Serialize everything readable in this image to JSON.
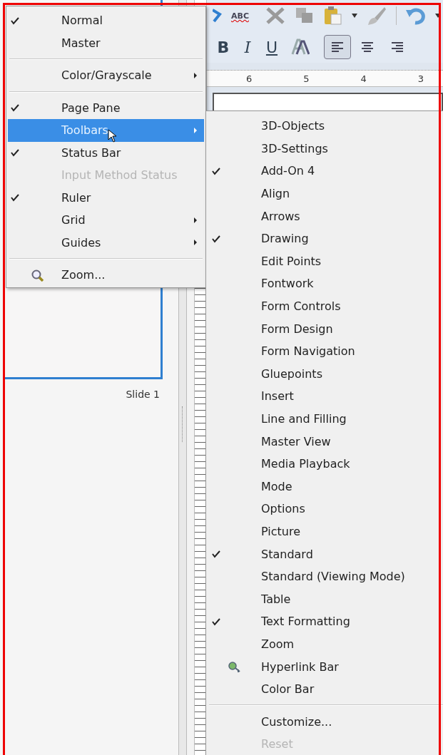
{
  "spelling_icon_text": "ABC",
  "format_buttons": [
    {
      "label": "B",
      "kind": "bold"
    },
    {
      "label": "I",
      "kind": "italic"
    },
    {
      "label": "U",
      "kind": "underline"
    }
  ],
  "align_buttons": [
    {
      "pressed": true
    },
    {
      "pressed": false
    },
    {
      "pressed": false
    }
  ],
  "ruler": {
    "labels": [
      "6",
      "5",
      "4",
      "3"
    ]
  },
  "slide_pane": {
    "thumbnails": [
      {
        "label": "Slide 1",
        "selected": true
      }
    ]
  },
  "view_menu": {
    "items": [
      {
        "kind": "item",
        "label": "Normal",
        "checked": true,
        "disabled": false,
        "selected": false,
        "submenu": false
      },
      {
        "kind": "item",
        "label": "Master",
        "checked": false,
        "disabled": false,
        "selected": false,
        "submenu": false
      },
      {
        "kind": "separator"
      },
      {
        "kind": "item",
        "label": "Color/Grayscale",
        "checked": false,
        "disabled": false,
        "selected": false,
        "submenu": true
      },
      {
        "kind": "separator"
      },
      {
        "kind": "item",
        "label": "Page Pane",
        "checked": true,
        "disabled": false,
        "selected": false,
        "submenu": false
      },
      {
        "kind": "item",
        "label": "Toolbars",
        "checked": false,
        "disabled": false,
        "selected": true,
        "submenu": true
      },
      {
        "kind": "item",
        "label": "Status Bar",
        "checked": true,
        "disabled": false,
        "selected": false,
        "submenu": false
      },
      {
        "kind": "item",
        "label": "Input Method Status",
        "checked": false,
        "disabled": true,
        "selected": false,
        "submenu": false
      },
      {
        "kind": "item",
        "label": "Ruler",
        "checked": true,
        "disabled": false,
        "selected": false,
        "submenu": false
      },
      {
        "kind": "item",
        "label": "Grid",
        "checked": false,
        "disabled": false,
        "selected": false,
        "submenu": true
      },
      {
        "kind": "item",
        "label": "Guides",
        "checked": false,
        "disabled": false,
        "selected": false,
        "submenu": true
      },
      {
        "kind": "separator"
      },
      {
        "kind": "zoom_item",
        "label": "Zoom...",
        "checked": false,
        "disabled": false,
        "selected": false,
        "submenu": false
      }
    ]
  },
  "toolbars_submenu": {
    "items": [
      {
        "kind": "item",
        "label": "3D-Objects",
        "checked": false,
        "disabled": false
      },
      {
        "kind": "item",
        "label": "3D-Settings",
        "checked": false,
        "disabled": false
      },
      {
        "kind": "item",
        "label": "Add-On 4",
        "checked": true,
        "disabled": false
      },
      {
        "kind": "item",
        "label": "Align",
        "checked": false,
        "disabled": false
      },
      {
        "kind": "item",
        "label": "Arrows",
        "checked": false,
        "disabled": false
      },
      {
        "kind": "item",
        "label": "Drawing",
        "checked": true,
        "disabled": false
      },
      {
        "kind": "item",
        "label": "Edit Points",
        "checked": false,
        "disabled": false
      },
      {
        "kind": "item",
        "label": "Fontwork",
        "checked": false,
        "disabled": false
      },
      {
        "kind": "item",
        "label": "Form Controls",
        "checked": false,
        "disabled": false
      },
      {
        "kind": "item",
        "label": "Form Design",
        "checked": false,
        "disabled": false
      },
      {
        "kind": "item",
        "label": "Form Navigation",
        "checked": false,
        "disabled": false
      },
      {
        "kind": "item",
        "label": "Gluepoints",
        "checked": false,
        "disabled": false
      },
      {
        "kind": "item",
        "label": "Insert",
        "checked": false,
        "disabled": false
      },
      {
        "kind": "item",
        "label": "Line and Filling",
        "checked": false,
        "disabled": false
      },
      {
        "kind": "item",
        "label": "Master View",
        "checked": false,
        "disabled": false
      },
      {
        "kind": "item",
        "label": "Media Playback",
        "checked": false,
        "disabled": false
      },
      {
        "kind": "item",
        "label": "Mode",
        "checked": false,
        "disabled": false
      },
      {
        "kind": "item",
        "label": "Options",
        "checked": false,
        "disabled": false
      },
      {
        "kind": "item",
        "label": "Picture",
        "checked": false,
        "disabled": false
      },
      {
        "kind": "item",
        "label": "Standard",
        "checked": true,
        "disabled": false
      },
      {
        "kind": "item",
        "label": "Standard (Viewing Mode)",
        "checked": false,
        "disabled": false
      },
      {
        "kind": "item",
        "label": "Table",
        "checked": false,
        "disabled": false
      },
      {
        "kind": "item",
        "label": "Text Formatting",
        "checked": true,
        "disabled": false
      },
      {
        "kind": "item",
        "label": "Zoom",
        "checked": false,
        "disabled": false
      },
      {
        "kind": "hyperlink_item",
        "label": "Hyperlink Bar",
        "checked": false,
        "disabled": false
      },
      {
        "kind": "item",
        "label": "Color Bar",
        "checked": false,
        "disabled": false
      },
      {
        "kind": "separator"
      },
      {
        "kind": "item",
        "label": "Customize...",
        "checked": false,
        "disabled": false
      },
      {
        "kind": "item",
        "label": "Reset",
        "checked": false,
        "disabled": true
      }
    ]
  }
}
